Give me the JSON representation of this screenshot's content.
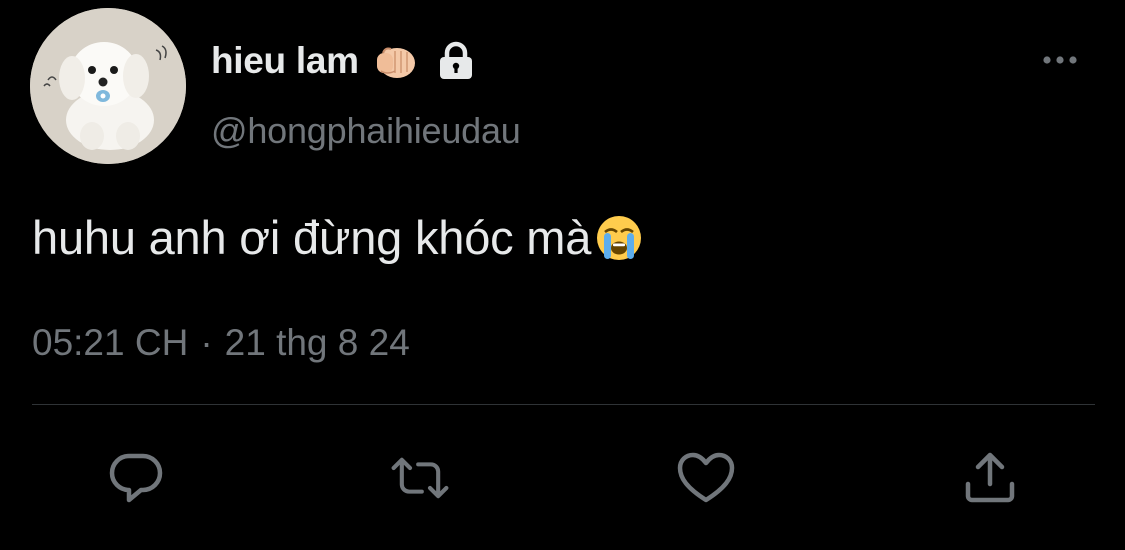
{
  "tweet": {
    "author": {
      "display_name": "hieu lam",
      "handle": "@hongphaihieudau",
      "protected": true
    },
    "text": "huhu anh ơi đừng khóc mà",
    "emoji_name": "loudly-crying-face",
    "timestamp": {
      "time": "05:21 CH",
      "separator": "·",
      "date": "21 thg 8 24"
    },
    "actions": [
      "reply",
      "retweet",
      "like",
      "share"
    ]
  },
  "colors": {
    "background": "#000000",
    "text": "#e7e9ea",
    "secondary": "#71767b",
    "divider": "#2f3336"
  }
}
